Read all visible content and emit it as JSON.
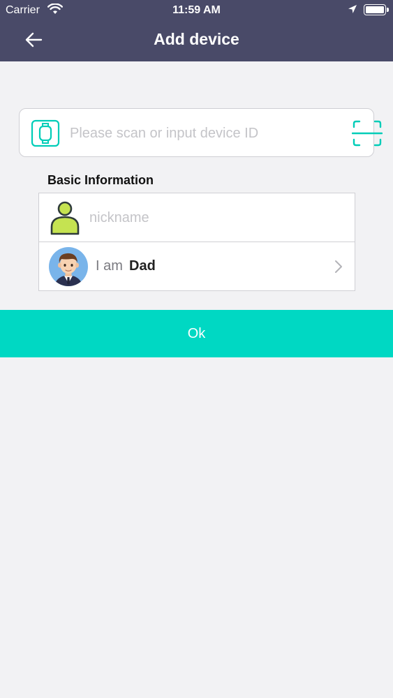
{
  "status_bar": {
    "carrier": "Carrier",
    "time": "11:59 AM"
  },
  "nav": {
    "title": "Add device"
  },
  "device_input": {
    "placeholder": "Please scan or input device ID",
    "value": ""
  },
  "basic_info": {
    "title": "Basic Information",
    "nickname_placeholder": "nickname",
    "relation_label": "I am",
    "relation_value": "Dad"
  },
  "actions": {
    "ok_label": "Ok"
  },
  "colors": {
    "nav_bar": "#494a68",
    "accent": "#00d8c3",
    "person_icon": "#c5e351",
    "background": "#f2f2f4"
  },
  "icons": [
    "wifi-icon",
    "location-arrow-icon",
    "battery-icon",
    "back-arrow-icon",
    "watch-icon",
    "scan-icon",
    "person-icon",
    "avatar",
    "chevron-right-icon"
  ]
}
